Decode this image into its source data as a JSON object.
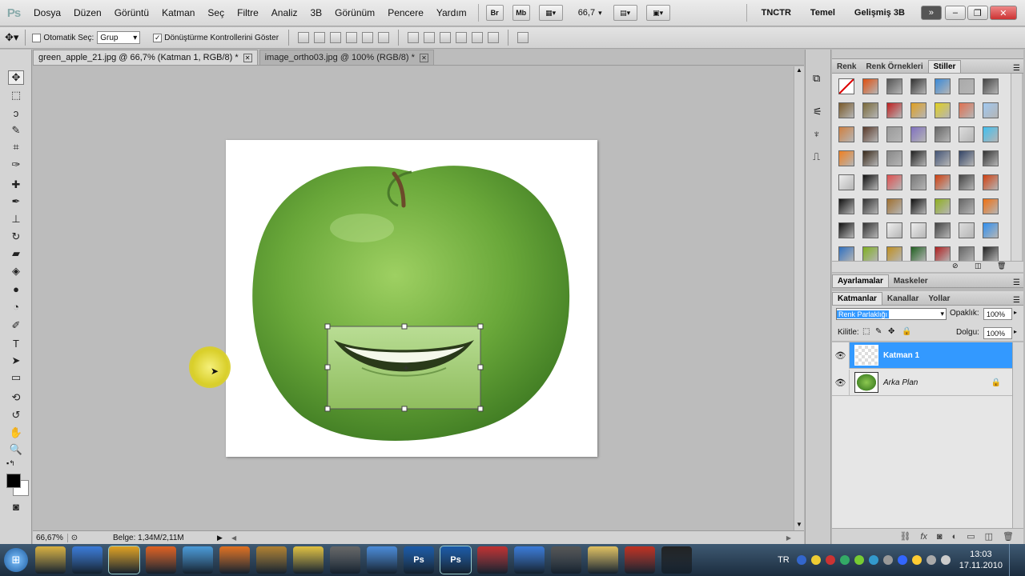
{
  "app": {
    "logo": "Ps"
  },
  "menu": {
    "items": [
      "Dosya",
      "Düzen",
      "Görüntü",
      "Katman",
      "Seç",
      "Filtre",
      "Analiz",
      "3B",
      "Görünüm",
      "Pencere",
      "Yardım"
    ],
    "bridge_label": "Br",
    "minibridge_label": "Mb",
    "zoom": "66,7",
    "workspaces": [
      "TNCTR",
      "Temel",
      "Gelişmiş 3B"
    ],
    "more": "»"
  },
  "options": {
    "auto_select_label": "Otomatik Seç:",
    "auto_select_value": "Grup",
    "transform_controls_label": "Dönüştürme Kontrollerini Göster",
    "transform_checked": "✓"
  },
  "tabs": [
    {
      "label": "green_apple_21.jpg @ 66,7% (Katman 1, RGB/8) *"
    },
    {
      "label": "image_ortho03.jpg @ 100% (RGB/8) *"
    }
  ],
  "status": {
    "zoom": "66,67%",
    "doc": "Belge: 1,34M/2,11M"
  },
  "styles_panel": {
    "tabs": [
      "Renk",
      "Renk Örnekleri",
      "Stiller"
    ],
    "swatches": [
      "#ffffff",
      "#e05010",
      "#555555",
      "#333333",
      "#3a8ad8",
      "#aaaaaa",
      "#444444",
      "#7a5a2a",
      "#7a6a3a",
      "#c02020",
      "#e0a020",
      "#e0d020",
      "#e07050",
      "#a0c8f0",
      "#d08040",
      "#5a3a2a",
      "#9a9a9a",
      "#8070c0",
      "#666666",
      "#dddddd",
      "#40c0f0",
      "#f08020",
      "#3a2a1a",
      "#888888",
      "#222222",
      "#445577",
      "#334466",
      "#333333",
      "#eeeeee",
      "#111111",
      "#e05050",
      "#777777",
      "#d04010",
      "#444444",
      "#d04010",
      "#111111",
      "#333333",
      "#a07030",
      "#111111",
      "#90b020",
      "#666666",
      "#f07010",
      "#111111",
      "#333333",
      "#f0f0f0",
      "#eeeeee",
      "#444444",
      "#dddddd",
      "#3090f0",
      "#3070c0",
      "#80b020",
      "#c09020",
      "#206020",
      "#b02020",
      "#666666",
      "#222222"
    ]
  },
  "adjust_panel": {
    "tabs": [
      "Ayarlamalar",
      "Maskeler"
    ]
  },
  "layers_panel": {
    "tabs": [
      "Katmanlar",
      "Kanallar",
      "Yollar"
    ],
    "blend_mode": "Renk Parlaklığı",
    "opacity_label": "Opaklık:",
    "opacity": "100%",
    "lock_label": "Kilitle:",
    "fill_label": "Dolgu:",
    "fill": "100%",
    "layers": [
      {
        "name": "Katman 1",
        "selected": true
      },
      {
        "name": "Arka Plan",
        "selected": false
      }
    ]
  },
  "taskbar": {
    "apps": [
      "",
      "",
      "",
      "",
      "",
      "",
      "",
      "",
      "",
      "",
      "Ps",
      "Ps",
      "",
      "",
      "",
      "",
      "",
      ""
    ],
    "lang": "TR",
    "time": "13:03",
    "date": "17.11.2010"
  },
  "colors": {
    "accent": "#3399ff",
    "selected_layer": "#3399ff",
    "apple": "#6aa83a"
  }
}
